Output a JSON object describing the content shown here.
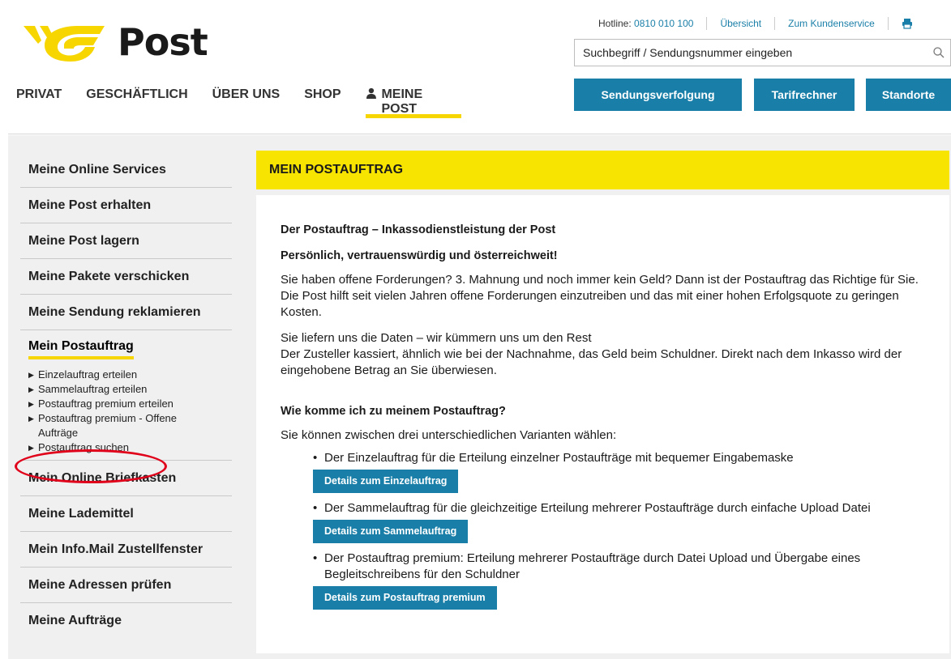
{
  "brand": {
    "logo_text": "Post",
    "logo_color": "#f7d600"
  },
  "topbar": {
    "hotline_label": "Hotline:",
    "hotline_number": "0810 010 100",
    "overview": "Übersicht",
    "customer_service": "Zum Kundenservice"
  },
  "search": {
    "placeholder": "Suchbegriff / Sendungsnummer eingeben"
  },
  "mainnav": [
    "PRIVAT",
    "GESCHÄFTLICH",
    "ÜBER UNS",
    "SHOP",
    "MEINE POST"
  ],
  "quick_buttons": [
    "Sendungsverfolgung",
    "Tarifrechner",
    "Standorte"
  ],
  "sidebar": {
    "items_top": [
      "Meine Online Services",
      "Meine Post erhalten",
      "Meine Post lagern",
      "Meine Pakete verschicken",
      "Meine Sendung reklamieren"
    ],
    "active": "Mein Postauftrag",
    "sub_items": [
      "Einzelauftrag erteilen",
      "Sammelauftrag erteilen",
      "Postauftrag premium erteilen",
      "Postauftrag premium - Offene Aufträge",
      "Postauftrag suchen"
    ],
    "items_bottom": [
      "Mein Online Briefkasten",
      "Meine Lademittel",
      "Mein Info.Mail Zustellfenster",
      "Meine Adressen prüfen",
      "Meine Aufträge"
    ]
  },
  "content": {
    "title": "MEIN POSTAUFTRAG",
    "heading1": "Der Postauftrag – Inkassodienstleistung der Post",
    "heading2": "Persönlich, vertrauenswürdig und österreichweit!",
    "para1": "Sie haben offene Forderungen? 3. Mahnung und noch immer kein Geld? Dann ist der Postauftrag das Richtige für Sie. Die Post hilft seit vielen Jahren offene Forderungen einzutreiben und das mit einer hohen Erfolgsquote zu geringen Kosten.",
    "para2_line1": "Sie liefern uns die Daten – wir kümmern uns um den Rest",
    "para2_line2": "Der Zusteller kassiert, ähnlich wie bei der Nachnahme, das Geld beim Schuldner. Direkt nach dem Inkasso wird der eingehobene Betrag an Sie überwiesen.",
    "heading3": "Wie komme ich zu meinem Postauftrag?",
    "para3": "Sie können zwischen drei unterschiedlichen Varianten wählen:",
    "options": [
      {
        "text": "Der Einzelauftrag für die Erteilung einzelner Postaufträge mit bequemer Eingabemaske",
        "button": "Details zum Einzelauftrag"
      },
      {
        "text": "Der Sammelauftrag für die gleichzeitige Erteilung mehrerer Postaufträge durch einfache Upload Datei",
        "button": "Details zum Sammelauftrag"
      },
      {
        "text": "Der Postauftrag premium: Erteilung mehrerer Postaufträge durch Datei Upload und Übergabe eines Begleitschreibens für den Schuldner",
        "button": "Details zum Postauftrag premium"
      }
    ]
  },
  "colors": {
    "accent_blue": "#1a7fa8",
    "yellow": "#f7d600",
    "highlight_red": "#e0001a"
  }
}
